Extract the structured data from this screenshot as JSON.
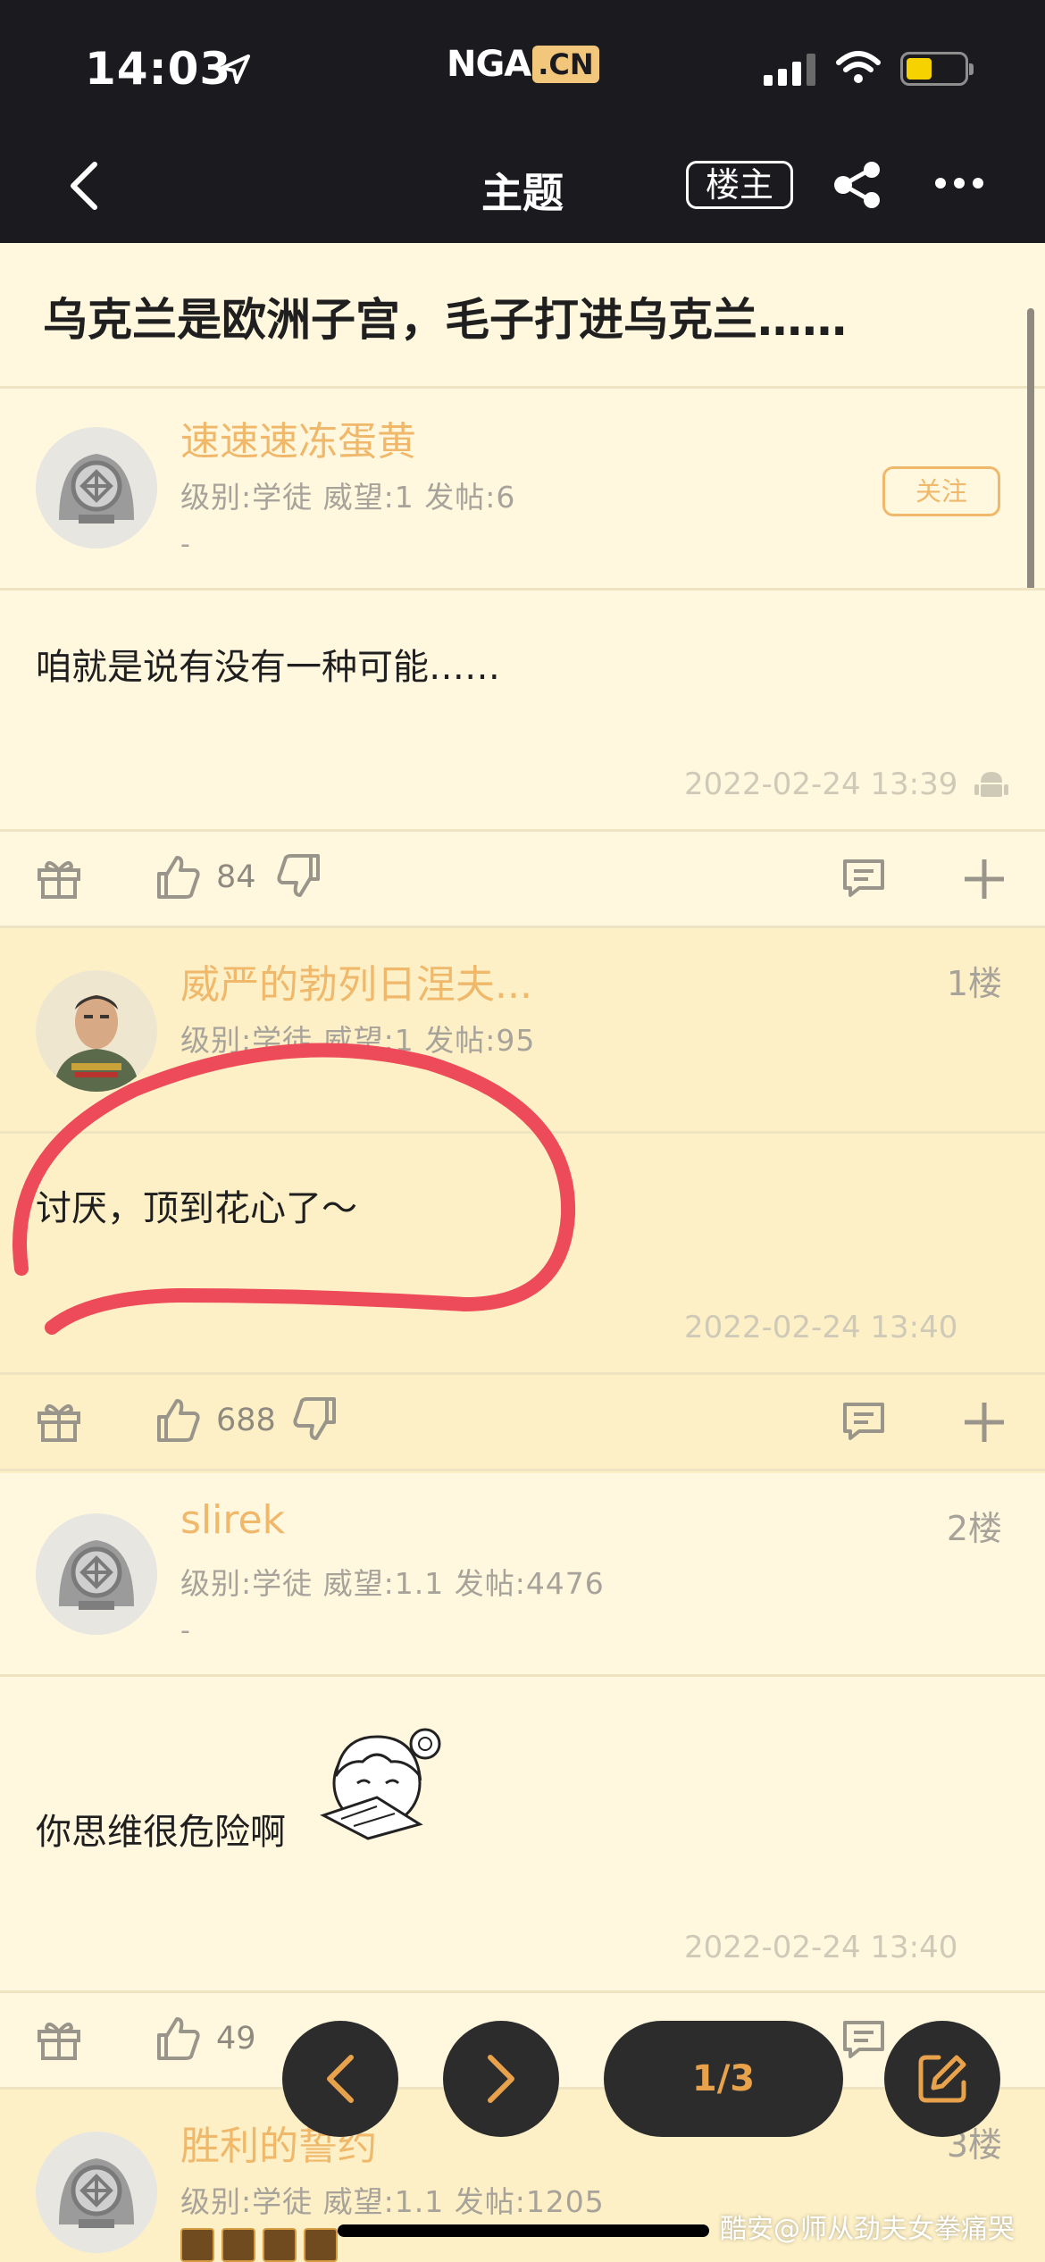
{
  "status_bar": {
    "time": "14:03",
    "logo_text": "NGA",
    "logo_domain": ".CN"
  },
  "nav": {
    "title": "主题",
    "op_button": "楼主"
  },
  "topic": {
    "title": "乌克兰是欧洲子宫，毛子打进乌克兰……"
  },
  "posts": [
    {
      "username": "速速速冻蛋黄",
      "info": "级别:学徒   威望:1   发帖:6",
      "signature": "-",
      "follow_label": "关注",
      "content": "咱就是说有没有一种可能……",
      "timestamp": "2022-02-24 13:39",
      "likes": "84"
    },
    {
      "username": "威严的勃列日涅夫...",
      "floor": "1楼",
      "info": "级别:学徒   威望:1   发帖:95",
      "content": "讨厌，顶到花心了～",
      "timestamp": "2022-02-24 13:40",
      "likes": "688"
    },
    {
      "username": "slirek",
      "floor": "2楼",
      "info": "级别:学徒   威望:1.1   发帖:4476",
      "signature": "-",
      "content": "你思维很危险啊",
      "timestamp": "2022-02-24 13:40",
      "likes": "49"
    },
    {
      "username": "胜利的誓约",
      "floor": "3楼",
      "info": "级别:学徒   威望:1.1   发帖:1205"
    }
  ],
  "pagination": {
    "page": "1/3"
  },
  "watermark": "酷安@师从劲夫女拳痛哭",
  "colors": {
    "accent": "#efb86b",
    "background": "#fff8df",
    "highlight": "#fdf0c6",
    "annotation": "#ee4b5a"
  }
}
